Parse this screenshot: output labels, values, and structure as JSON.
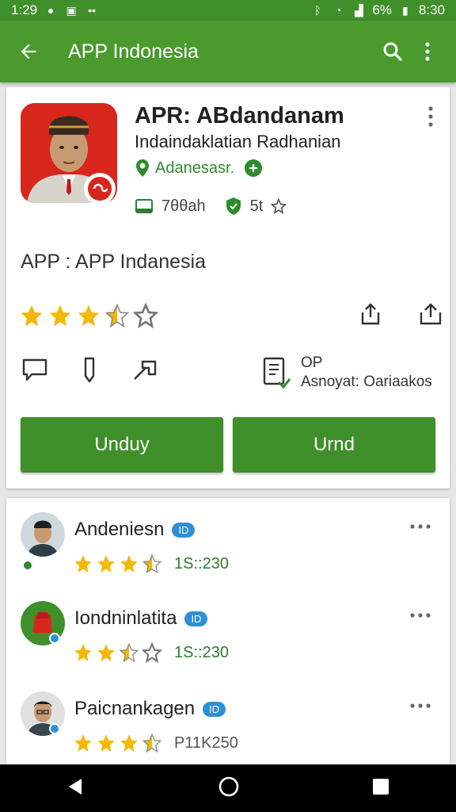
{
  "status_bar": {
    "time_left": "1:29",
    "battery": "6%",
    "time_right": "8:30"
  },
  "app_bar": {
    "title": "APP Indonesia"
  },
  "app": {
    "name": "APR: ABdandanam",
    "developer": "Indaindaklatian  Radhanian",
    "tag": "Adanesasr.",
    "size": "7θθah",
    "rating_short": "5t",
    "subtitle": "APP : APP Indanesia",
    "rating_stars": 3.5
  },
  "info": {
    "line1": "OP",
    "line2": "Asnoyat: Oariaakos"
  },
  "buttons": {
    "primary": "Unduy",
    "secondary": "Urnd"
  },
  "reviews": [
    {
      "name": "Andeniesn",
      "badge": "ID",
      "stars": 3.5,
      "date": "1S::230"
    },
    {
      "name": "Iondninlatita",
      "badge": "ID",
      "stars": 2.5,
      "date": "1S::230"
    },
    {
      "name": "Paicnankagen",
      "badge": "ID",
      "stars": 3.5,
      "date": "P11K250"
    }
  ],
  "colors": {
    "accent": "#4a9a2d",
    "button": "#3f8f2a",
    "star": "#f5b800",
    "badge": "#2d8fd5"
  }
}
